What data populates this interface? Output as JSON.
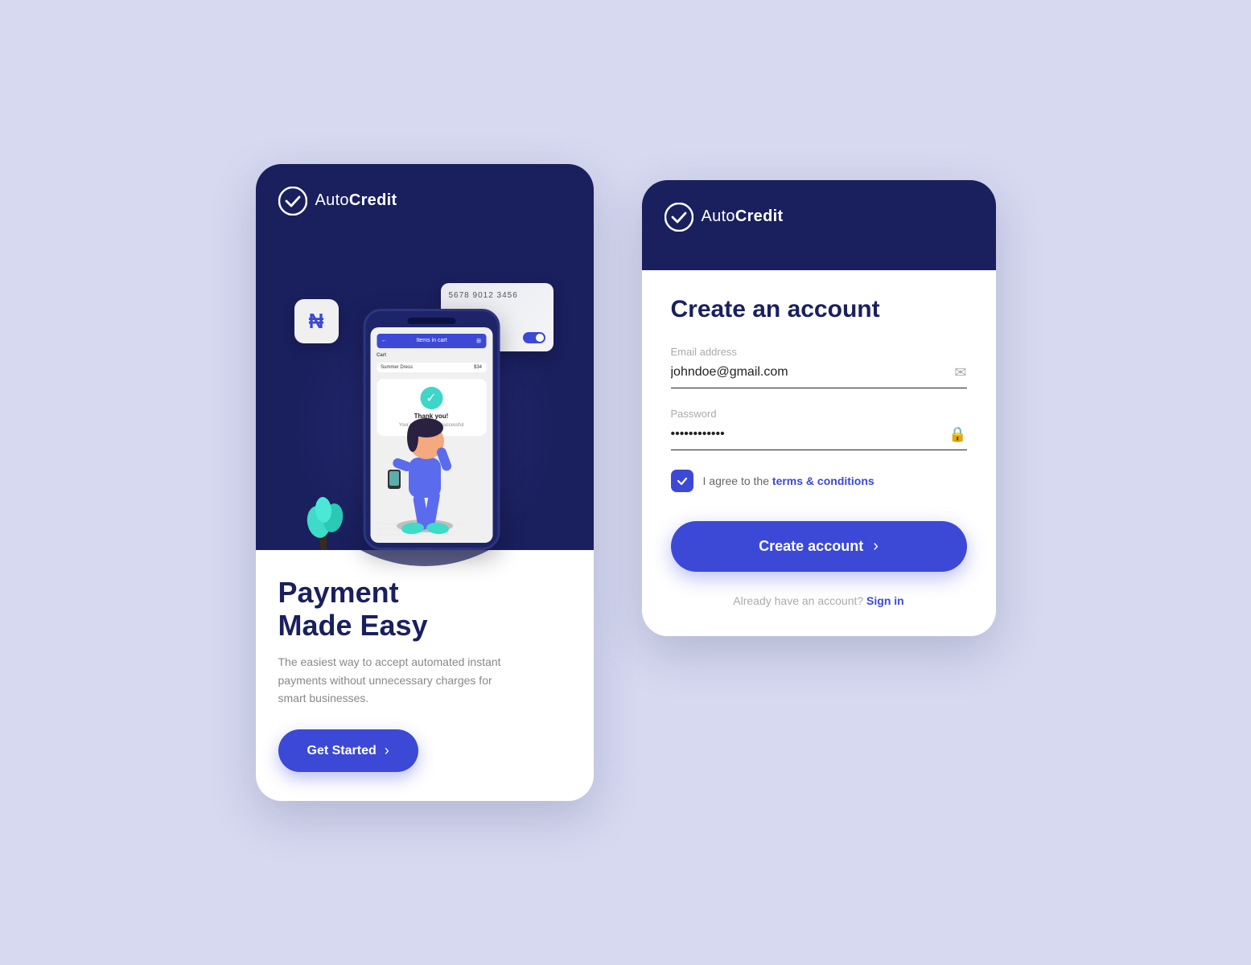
{
  "background_color": "#d6d9f0",
  "left_card": {
    "logo": {
      "text_regular": "Auto",
      "text_bold": "Credit"
    },
    "headline": "Payment\nMade Easy",
    "subtext": "The easiest way to accept automated instant payments without unnecessary charges for smart businesses.",
    "cta_button": "Get Started",
    "phone_mock": {
      "cart_label": "Items in cart",
      "item_label": "Summer Dress",
      "item_price": "$34",
      "thank_you": "Thank you!",
      "thank_you_sub": "Your purchase was\nsuccessful"
    },
    "card_number": "5678 9012 3456"
  },
  "right_card": {
    "logo": {
      "text_regular": "Auto",
      "text_bold": "Credit"
    },
    "form_title": "Create an account",
    "email_label": "Email address",
    "email_value": "johndoe@gmail.com",
    "password_label": "Password",
    "password_value": "************",
    "checkbox_text": "I agree to the ",
    "terms_text": "terms & conditions",
    "create_btn": "Create account",
    "signin_text": "Already have an account?",
    "signin_link": "Sign in"
  }
}
